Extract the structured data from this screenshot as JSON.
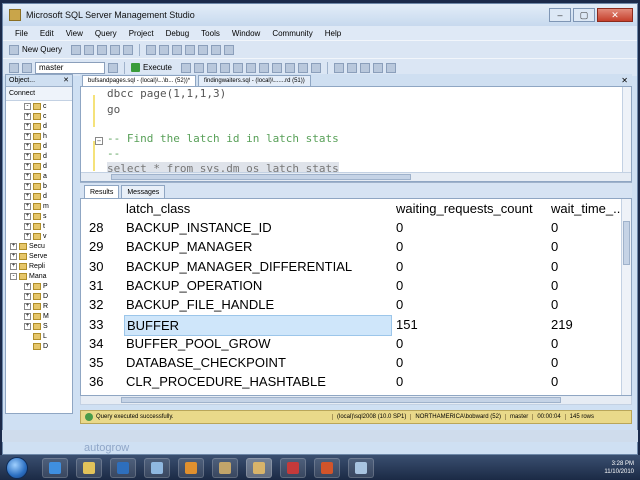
{
  "window": {
    "title": "Microsoft SQL Server Management Studio"
  },
  "menu": [
    "File",
    "Edit",
    "View",
    "Query",
    "Project",
    "Debug",
    "Tools",
    "Window",
    "Community",
    "Help"
  ],
  "toolbar": {
    "new_query_label": "New Query",
    "database": "master",
    "execute_label": "Execute"
  },
  "object_explorer": {
    "header": "Object...",
    "connect_label": "Connect",
    "tree": [
      {
        "toggle": "-",
        "label": "c"
      },
      {
        "toggle": "+",
        "label": "c"
      },
      {
        "toggle": "+",
        "label": "d"
      },
      {
        "toggle": "+",
        "label": "h"
      },
      {
        "toggle": "+",
        "label": "d"
      },
      {
        "toggle": "+",
        "label": "d"
      },
      {
        "toggle": "+",
        "label": "d"
      },
      {
        "toggle": "+",
        "label": "a"
      },
      {
        "toggle": "+",
        "label": "b"
      },
      {
        "toggle": "+",
        "label": "d"
      },
      {
        "toggle": "+",
        "label": "m"
      },
      {
        "toggle": "+",
        "label": "s"
      },
      {
        "toggle": "+",
        "label": "t"
      },
      {
        "toggle": "+",
        "label": "v"
      },
      {
        "toggle": "+",
        "label": "Secu"
      },
      {
        "toggle": "+",
        "label": "Serve"
      },
      {
        "toggle": "+",
        "label": "Repli"
      },
      {
        "toggle": "-",
        "label": "Mana"
      },
      {
        "toggle": "+",
        "label": "P"
      },
      {
        "toggle": "+",
        "label": "D"
      },
      {
        "toggle": "+",
        "label": "R"
      },
      {
        "toggle": "+",
        "label": "M"
      },
      {
        "toggle": "+",
        "label": "S"
      },
      {
        "toggle": "",
        "label": "L"
      },
      {
        "toggle": "",
        "label": "D"
      }
    ]
  },
  "doc_tabs": [
    "bufsandpages.sql - (local)\\...\\b... (52))*",
    "findingwaiters.sql - (local)\\.......rd (51))"
  ],
  "code": {
    "line1": "dbcc page(1,1,1,3)",
    "line2": "go",
    "line3": "-- Find the latch id in latch stats",
    "line4": "--",
    "line5": "select * from sys.dm_os_latch_stats"
  },
  "result_tabs": {
    "results": "Results",
    "messages": "Messages"
  },
  "grid": {
    "columns": [
      "latch_class",
      "waiting_requests_count",
      "wait_time_..."
    ],
    "rows": [
      {
        "num": "28",
        "latch_class": "BACKUP_INSTANCE_ID",
        "waiting": "0",
        "wait_time": "0"
      },
      {
        "num": "29",
        "latch_class": "BACKUP_MANAGER",
        "waiting": "0",
        "wait_time": "0"
      },
      {
        "num": "30",
        "latch_class": "BACKUP_MANAGER_DIFFERENTIAL",
        "waiting": "0",
        "wait_time": "0"
      },
      {
        "num": "31",
        "latch_class": "BACKUP_OPERATION",
        "waiting": "0",
        "wait_time": "0"
      },
      {
        "num": "32",
        "latch_class": "BACKUP_FILE_HANDLE",
        "waiting": "0",
        "wait_time": "0"
      },
      {
        "num": "33",
        "latch_class": "BUFFER",
        "waiting": "151",
        "wait_time": "219"
      },
      {
        "num": "34",
        "latch_class": "BUFFER_POOL_GROW",
        "waiting": "0",
        "wait_time": "0"
      },
      {
        "num": "35",
        "latch_class": "DATABASE_CHECKPOINT",
        "waiting": "0",
        "wait_time": "0"
      },
      {
        "num": "36",
        "latch_class": "CLR_PROCEDURE_HASHTABLE",
        "waiting": "0",
        "wait_time": "0"
      }
    ]
  },
  "status": {
    "message": "Query executed successfully.",
    "server": "(local)\\sql2008 (10.0 SP1)",
    "user": "NORTHAMERICA\\bobward (52)",
    "database": "master",
    "elapsed": "00:00:04",
    "rows": "145 rows"
  },
  "desktop_label": "autogrow",
  "clock": {
    "time": "3:28 PM",
    "date": "11/10/2010"
  },
  "colors": {
    "status_bar": "#e9d98a",
    "selection": "#cfe6fa",
    "comment": "#58a058"
  }
}
